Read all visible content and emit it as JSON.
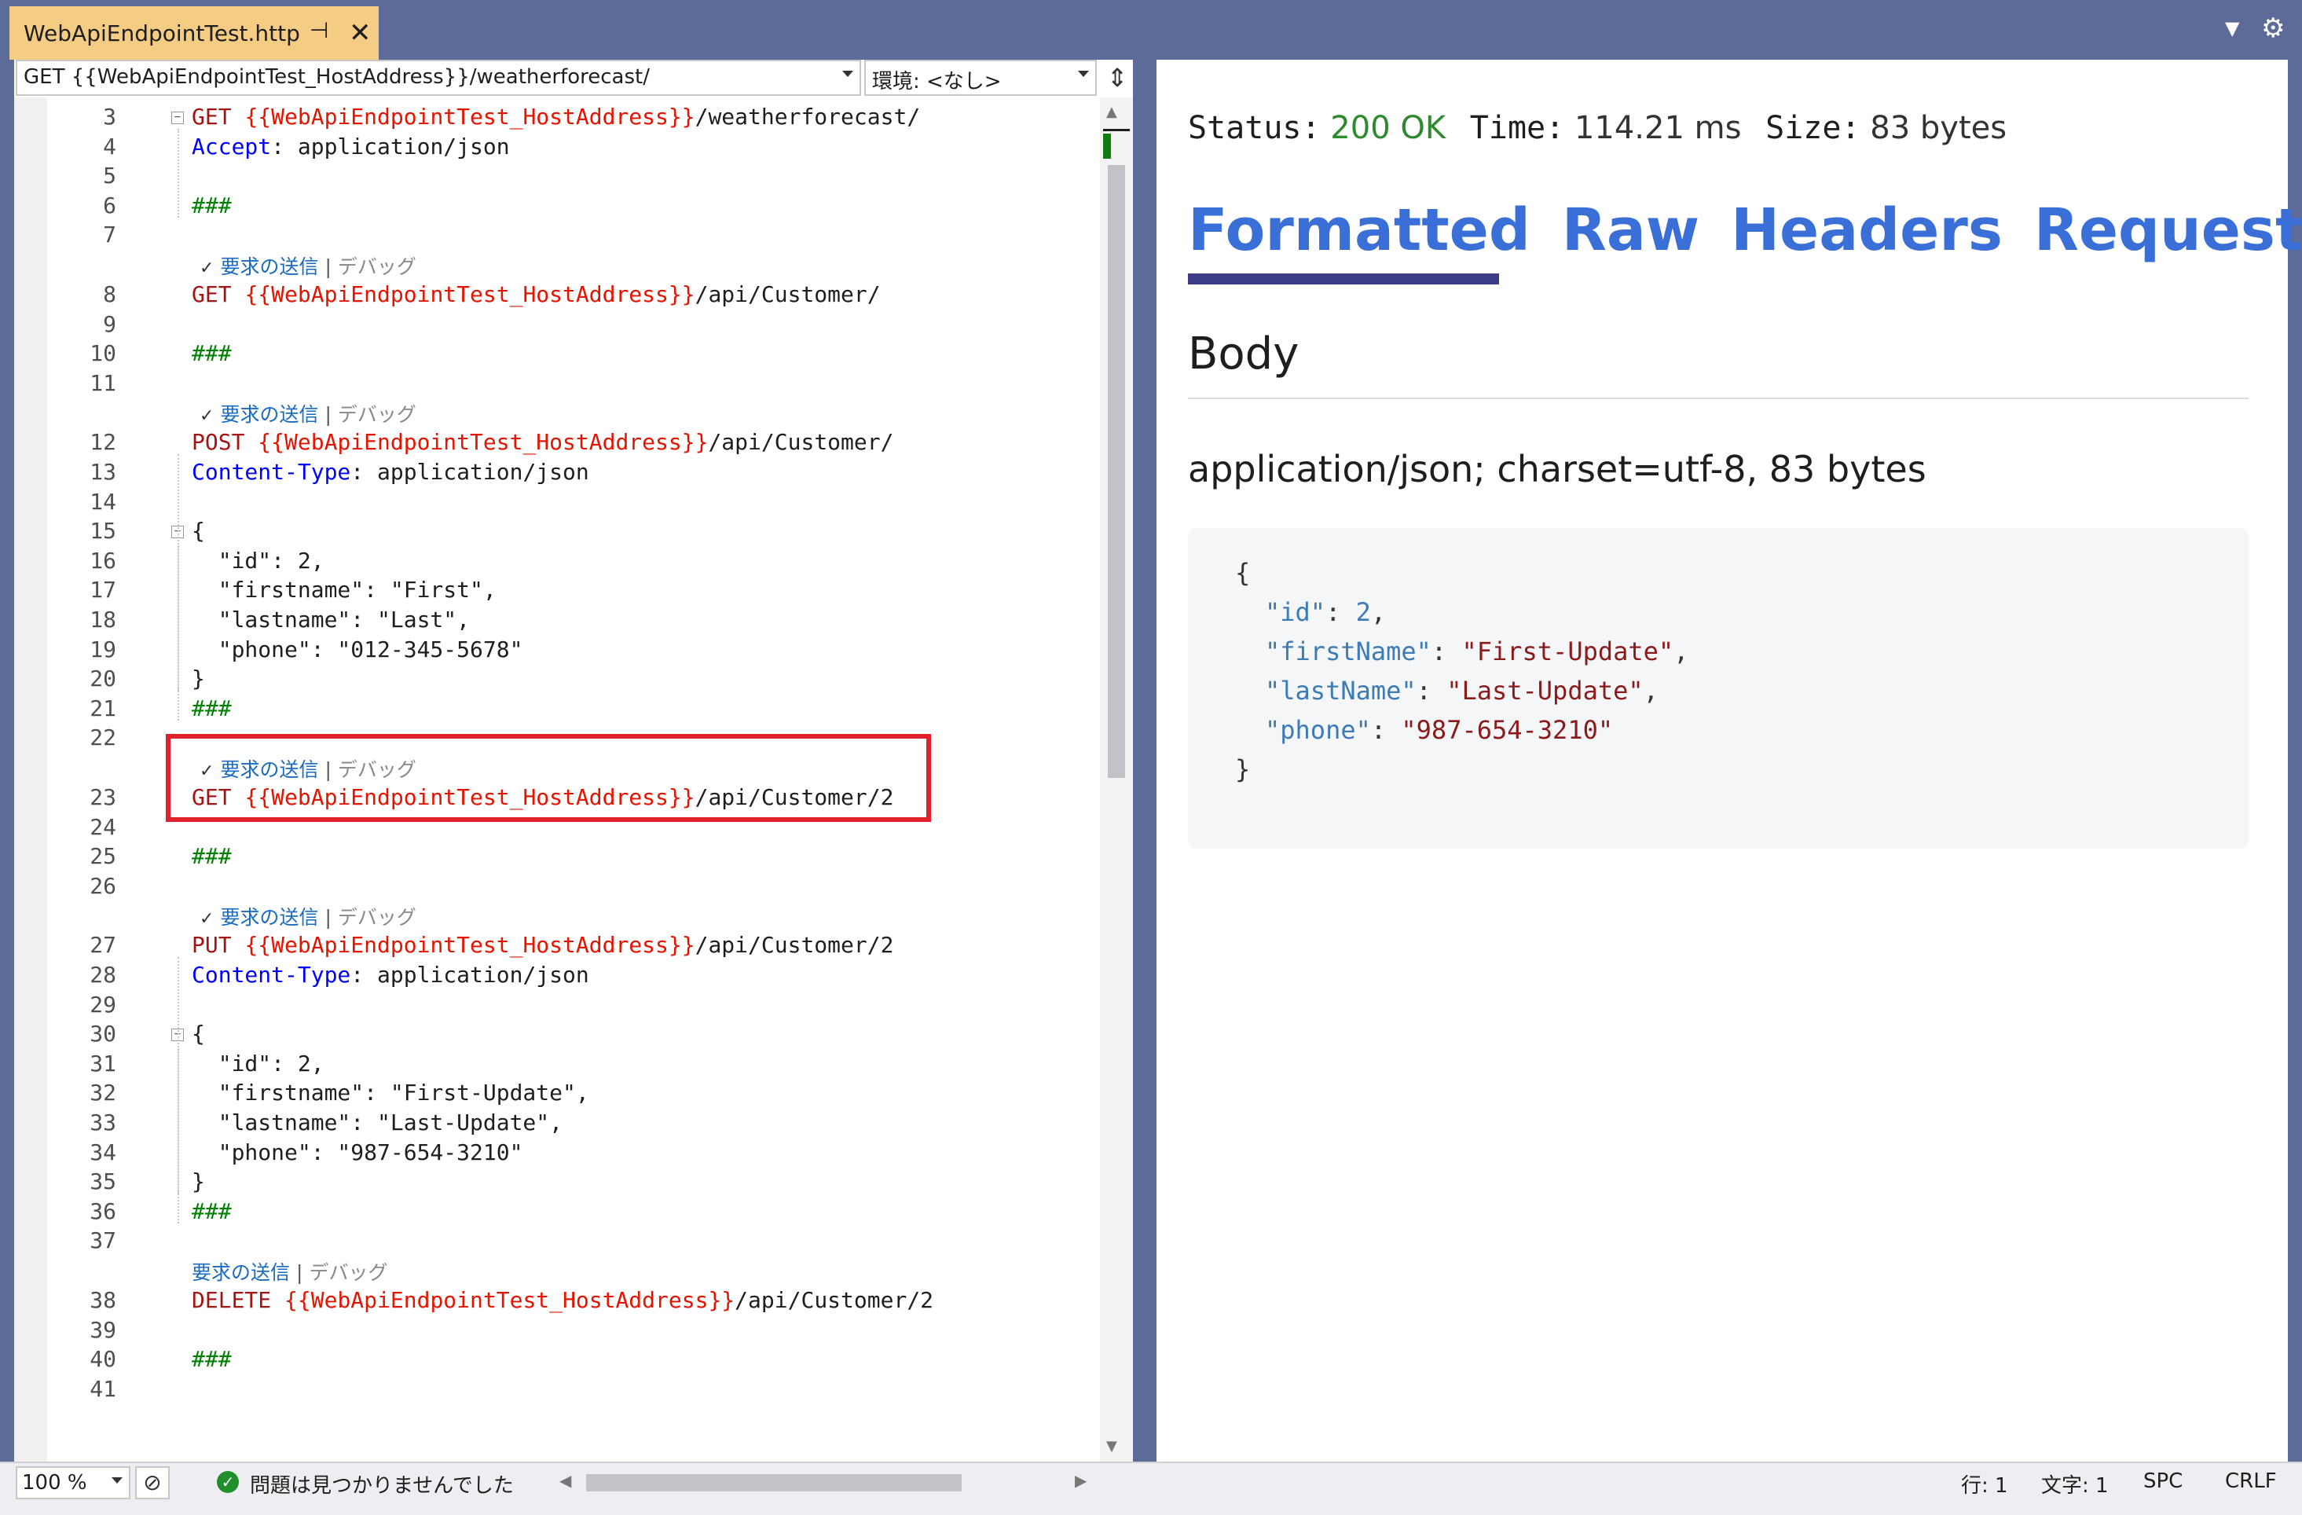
{
  "tab": {
    "title": "WebApiEndpointTest.http"
  },
  "editor": {
    "url_select": "GET {{WebApiEndpointTest_HostAddress}}/weatherforecast/",
    "env_select": "環境: <なし>",
    "codelens": {
      "send": "要求の送信",
      "separator": "|",
      "debug": "デバッグ"
    },
    "lines": {
      "l3": {
        "n": "3",
        "method": "GET ",
        "var": "{{WebApiEndpointTest_HostAddress}}",
        "rest": "/weatherforecast/"
      },
      "l4": {
        "n": "4",
        "hname": "Accept",
        "hval": ": application/json"
      },
      "l5": {
        "n": "5"
      },
      "l6": {
        "n": "6",
        "sep": "###"
      },
      "l7": {
        "n": "7"
      },
      "l8": {
        "n": "8",
        "method": "GET ",
        "var": "{{WebApiEndpointTest_HostAddress}}",
        "rest": "/api/Customer/"
      },
      "l9": {
        "n": "9"
      },
      "l10": {
        "n": "10",
        "sep": "###"
      },
      "l11": {
        "n": "11"
      },
      "l12": {
        "n": "12",
        "method": "POST ",
        "var": "{{WebApiEndpointTest_HostAddress}}",
        "rest": "/api/Customer/"
      },
      "l13": {
        "n": "13",
        "hname": "Content-Type",
        "hval": ": application/json"
      },
      "l14": {
        "n": "14"
      },
      "l15": {
        "n": "15",
        "text": "{"
      },
      "l16": {
        "n": "16",
        "text": "  \"id\": 2,"
      },
      "l17": {
        "n": "17",
        "text": "  \"firstname\": \"First\","
      },
      "l18": {
        "n": "18",
        "text": "  \"lastname\": \"Last\","
      },
      "l19": {
        "n": "19",
        "text": "  \"phone\": \"012-345-5678\""
      },
      "l20": {
        "n": "20",
        "text": "}"
      },
      "l21": {
        "n": "21",
        "sep": "###"
      },
      "l22": {
        "n": "22"
      },
      "l23": {
        "n": "23",
        "method": "GET ",
        "var": "{{WebApiEndpointTest_HostAddress}}",
        "rest": "/api/Customer/2"
      },
      "l24": {
        "n": "24"
      },
      "l25": {
        "n": "25",
        "sep": "###"
      },
      "l26": {
        "n": "26"
      },
      "l27": {
        "n": "27",
        "method": "PUT ",
        "var": "{{WebApiEndpointTest_HostAddress}}",
        "rest": "/api/Customer/2"
      },
      "l28": {
        "n": "28",
        "hname": "Content-Type",
        "hval": ": application/json"
      },
      "l29": {
        "n": "29"
      },
      "l30": {
        "n": "30",
        "text": "{"
      },
      "l31": {
        "n": "31",
        "text": "  \"id\": 2,"
      },
      "l32": {
        "n": "32",
        "text": "  \"firstname\": \"First-Update\","
      },
      "l33": {
        "n": "33",
        "text": "  \"lastname\": \"Last-Update\","
      },
      "l34": {
        "n": "34",
        "text": "  \"phone\": \"987-654-3210\""
      },
      "l35": {
        "n": "35",
        "text": "}"
      },
      "l36": {
        "n": "36",
        "sep": "###"
      },
      "l37": {
        "n": "37"
      },
      "l38": {
        "n": "38",
        "method": "DELETE ",
        "var": "{{WebApiEndpointTest_HostAddress}}",
        "rest": "/api/Customer/2"
      },
      "l39": {
        "n": "39"
      },
      "l40": {
        "n": "40",
        "sep": "###"
      },
      "l41": {
        "n": "41"
      }
    }
  },
  "response": {
    "status_label": "Status:",
    "status_value": "200 OK",
    "time_label": "Time:",
    "time_value": "114.21 ms",
    "size_label": "Size:",
    "size_value": "83 bytes",
    "tabs": [
      "Formatted",
      "Raw",
      "Headers",
      "Request"
    ],
    "active_tab": "Formatted",
    "body_heading": "Body",
    "content_type": "application/json; charset=utf-8, 83 bytes",
    "json": {
      "open": "{",
      "id_key": "\"id\"",
      "id_val": "2",
      "first_key": "\"firstName\"",
      "first_val": "\"First-Update\"",
      "last_key": "\"lastName\"",
      "last_val": "\"Last-Update\"",
      "phone_key": "\"phone\"",
      "phone_val": "\"987-654-3210\"",
      "close": "}"
    }
  },
  "statusbar": {
    "zoom": "100 %",
    "issues": "問題は見つかりませんでした",
    "line": "行: 1",
    "char": "文字: 1",
    "spc": "SPC",
    "eol": "CRLF"
  },
  "colors": {
    "accent_tab": "#f5cc84",
    "frame": "#5d6b99",
    "highlight": "#e0202a",
    "tab_link": "#3a6fd8",
    "tab_active_underline": "#3c3b88"
  }
}
